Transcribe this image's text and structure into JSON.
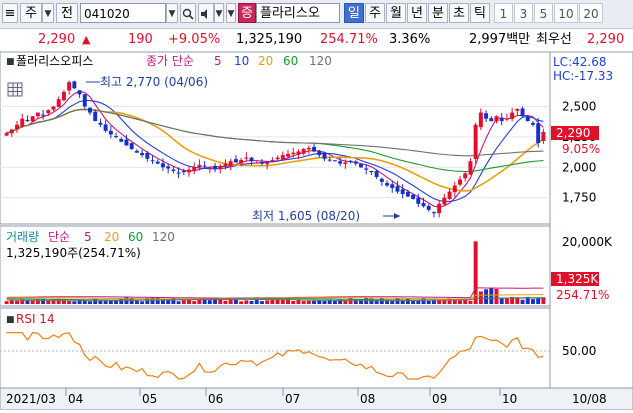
{
  "toolbar": {
    "market_btn": "주",
    "type_btn": "전",
    "code": "041020",
    "zeung_btn": "증",
    "stock_name": "플라리스오",
    "periods": [
      "일",
      "주",
      "월",
      "년",
      "분",
      "초",
      "틱"
    ],
    "selected_period": "일",
    "nums": [
      "1",
      "3",
      "5",
      "10",
      "20"
    ]
  },
  "quote": {
    "price": "2,290",
    "change": "190",
    "change_pct": "+9.05%",
    "volume": "1,325,190",
    "volume_pct": "254.71%",
    "turnover": "3.36%",
    "amount": "2,997백만",
    "best_ask_label": "최우선",
    "best_ask": "2,290"
  },
  "price_panel": {
    "stock_name": "폴라리스오피스",
    "indicator_label": "종가 단순",
    "ma_periods": [
      "5",
      "10",
      "20",
      "60",
      "120"
    ],
    "high_annotation": "최고 2,770 (04/06)",
    "low_annotation": "최저 1,605 (08/20)",
    "lc": "LC:42.68",
    "hc": "HC:-17.33",
    "y_ticks": [
      "2,500",
      "2,250",
      "2,000",
      "1,750"
    ],
    "current_price_tag": "2,290",
    "current_pct_tag": "9.05%"
  },
  "volume_panel": {
    "title": "거래량",
    "indicator_label": "단순",
    "ma_periods": [
      "5",
      "20",
      "60",
      "120"
    ],
    "volume_line": "1,325,190주(254.71%)",
    "y_tick": "20,000K",
    "current_tag": "1,325K",
    "current_pct_tag": "254.71%"
  },
  "rsi_panel": {
    "title": "RSI 14",
    "y_tick": "50.00"
  },
  "x_axis": {
    "labels": [
      "2021/03",
      "04",
      "05",
      "06",
      "07",
      "08",
      "09",
      "10"
    ],
    "right_label": "10/08"
  },
  "colors": {
    "up": "#e0102a",
    "down": "#1430c8",
    "ma5": "#c81878",
    "ma10": "#2240d8",
    "ma20": "#e8a010",
    "ma60": "#1a9a30",
    "ma120": "#707070",
    "rsi": "#f08010",
    "selected": "#3f6fd0"
  },
  "chart_data": {
    "type": "candlestick",
    "price_ylim": [
      1550,
      2800
    ],
    "start_label": "2021/03",
    "end_label": "10/08",
    "high": {
      "value": 2770,
      "date": "04/06"
    },
    "low": {
      "value": 1605,
      "date": "08/20"
    },
    "close": [
      2280,
      2310,
      2350,
      2400,
      2380,
      2420,
      2450,
      2430,
      2470,
      2500,
      2560,
      2620,
      2700,
      2650,
      2600,
      2500,
      2450,
      2380,
      2350,
      2300,
      2270,
      2250,
      2210,
      2180,
      2150,
      2120,
      2100,
      2070,
      2050,
      2030,
      2000,
      1990,
      1970,
      1950,
      1960,
      1980,
      2000,
      2020,
      2010,
      2000,
      1990,
      2010,
      2030,
      2050,
      2040,
      2060,
      2080,
      2050,
      2040,
      2030,
      2040,
      2060,
      2080,
      2100,
      2110,
      2120,
      2130,
      2150,
      2160,
      2130,
      2100,
      2070,
      2060,
      2050,
      2030,
      2040,
      2050,
      2030,
      2000,
      1980,
      1960,
      1920,
      1880,
      1850,
      1830,
      1800,
      1780,
      1760,
      1740,
      1700,
      1680,
      1650,
      1630,
      1700,
      1750,
      1800,
      1850,
      1900,
      1950,
      2050,
      2350,
      2450,
      2400,
      2380,
      2420,
      2380,
      2400,
      2450,
      2480,
      2420,
      2380,
      2350,
      2200,
      2290
    ],
    "volume_spike_pct": 254.71,
    "rsi_reference": 50
  }
}
